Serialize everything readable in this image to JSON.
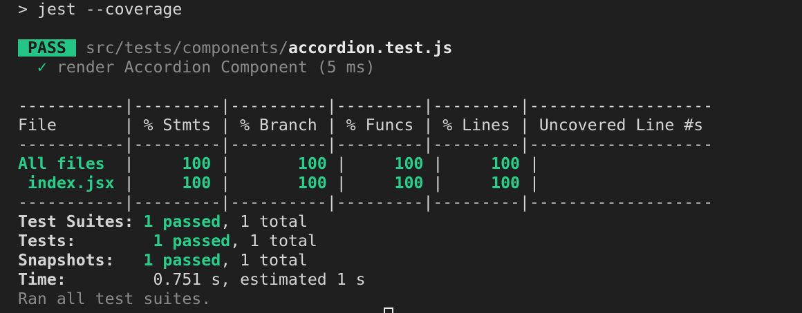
{
  "command": {
    "prompt": ">",
    "text": "jest --coverage"
  },
  "result": {
    "badge": "PASS",
    "path_dir": "src/tests/components/",
    "path_file": "accordion.test.js",
    "check": "✓",
    "test_name": "render Accordion Component (5 ms)"
  },
  "coverage_table": {
    "separator": "-----------|---------|----------|---------|---------|-------------------",
    "header": "File       | % Stmts | % Branch | % Funcs | % Lines | Uncovered Line #s ",
    "rows": [
      {
        "file": "All files  ",
        "stmts": "    100",
        "branch": "      100",
        "funcs": "    100",
        "lines": "    100",
        "uncovered": ""
      },
      {
        "file": " index.jsx ",
        "stmts": "    100",
        "branch": "      100",
        "funcs": "    100",
        "lines": "    100",
        "uncovered": ""
      }
    ]
  },
  "summary": {
    "suites_label": "Test Suites:",
    "suites_passed": "1 passed",
    "suites_rest": ", 1 total",
    "tests_label": "Tests:",
    "tests_passed": "1 passed",
    "tests_rest": ", 1 total",
    "snapshots_label": "Snapshots:",
    "snapshots_passed": "1 passed",
    "snapshots_rest": ", 1 total",
    "time_label": "Time:",
    "time_value": "0.751 s, estimated 1 s",
    "footer": "Ran all test suites."
  },
  "colors": {
    "background": "#1f1f1f",
    "pass_green": "#23d18b",
    "badge_bg": "#23c486",
    "dim": "#8a8a8a"
  }
}
